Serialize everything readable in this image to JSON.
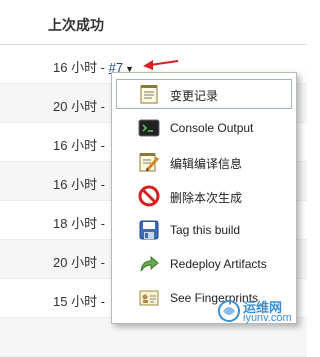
{
  "column_header": "上次成功",
  "rows": [
    {
      "time": "16 小时 - ",
      "build": "#7"
    },
    {
      "time": "20 小时 - ",
      "build": ""
    },
    {
      "time": "16 小时 - ",
      "build": ""
    },
    {
      "time": "16 小时 - ",
      "build": ""
    },
    {
      "time": "18 小时 - ",
      "build": ""
    },
    {
      "time": "20 小时 - ",
      "build": ""
    },
    {
      "time": "15 小时 - ",
      "build": ""
    },
    {
      "time": "",
      "build": ""
    }
  ],
  "context_menu": {
    "items": [
      {
        "label": "变更记录",
        "icon": "notepad-icon"
      },
      {
        "label": "Console Output",
        "icon": "terminal-icon"
      },
      {
        "label": "编辑编译信息",
        "icon": "notepad-pencil-icon"
      },
      {
        "label": "删除本次生成",
        "icon": "no-entry-icon"
      },
      {
        "label": "Tag this build",
        "icon": "save-icon"
      },
      {
        "label": "Redeploy Artifacts",
        "icon": "redeploy-arrow-icon"
      },
      {
        "label": "See Fingerprints",
        "icon": "fingerprint-card-icon"
      }
    ]
  },
  "watermark": {
    "line1": "运维网",
    "line2": "iyunv.com"
  },
  "colors": {
    "link": "#204a87",
    "arrow": "#e02020",
    "highlight_border": "#9ab3d2"
  }
}
